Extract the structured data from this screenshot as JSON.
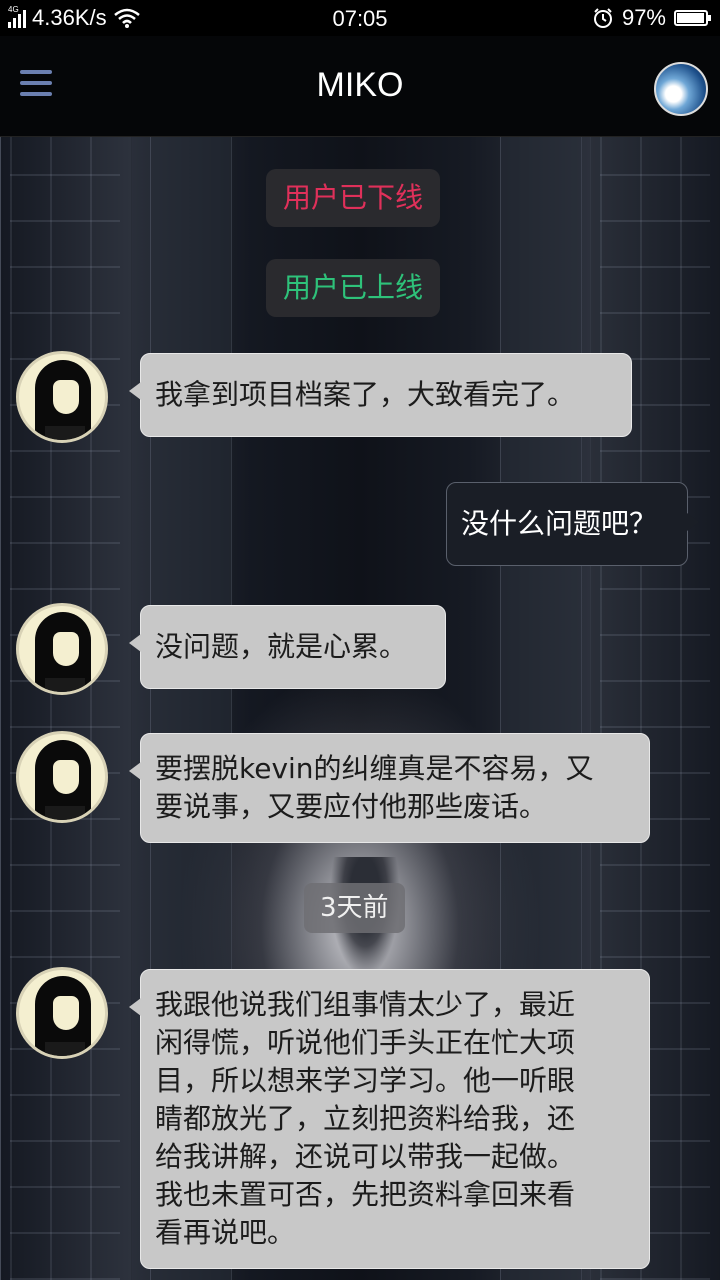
{
  "status_bar": {
    "network_type": "4G",
    "speed": "4.36K/s",
    "time": "07:05",
    "battery_percent": "97%",
    "battery_level": 0.97,
    "icons": [
      "signal-icon",
      "wifi-icon",
      "alarm-icon",
      "battery-icon"
    ]
  },
  "header": {
    "title": "MIKO",
    "menu_icon": "hamburger-menu-icon",
    "avatar": "profile-avatar"
  },
  "notices": {
    "offline": "用户已下线",
    "online": "用户已上线",
    "time_divider": "3天前"
  },
  "colors": {
    "offline": "#e0305a",
    "online": "#2ec27a",
    "incoming_bubble": "#c8c8c8",
    "outgoing_bubble": "#1a1e26",
    "menu_icon": "#6b7fb0"
  },
  "messages": [
    {
      "direction": "incoming",
      "text": "我拿到项目档案了，大致看完了。"
    },
    {
      "direction": "outgoing",
      "text": "没什么问题吧？"
    },
    {
      "direction": "incoming",
      "text": "没问题，就是心累。"
    },
    {
      "direction": "incoming",
      "lines": [
        "要摆脱kevin的纠缠真是不容易，又",
        "要说事，又要应付他那些废话。"
      ]
    },
    {
      "direction": "incoming",
      "lines": [
        "我跟他说我们组事情太少了，最近",
        "闲得慌，听说他们手头正在忙大项",
        "目，所以想来学习学习。他一听眼",
        "睛都放光了，立刻把资料给我，还",
        "给我讲解，还说可以带我一起做。",
        "我也未置可否，先把资料拿回来看",
        "看再说吧。"
      ]
    }
  ]
}
